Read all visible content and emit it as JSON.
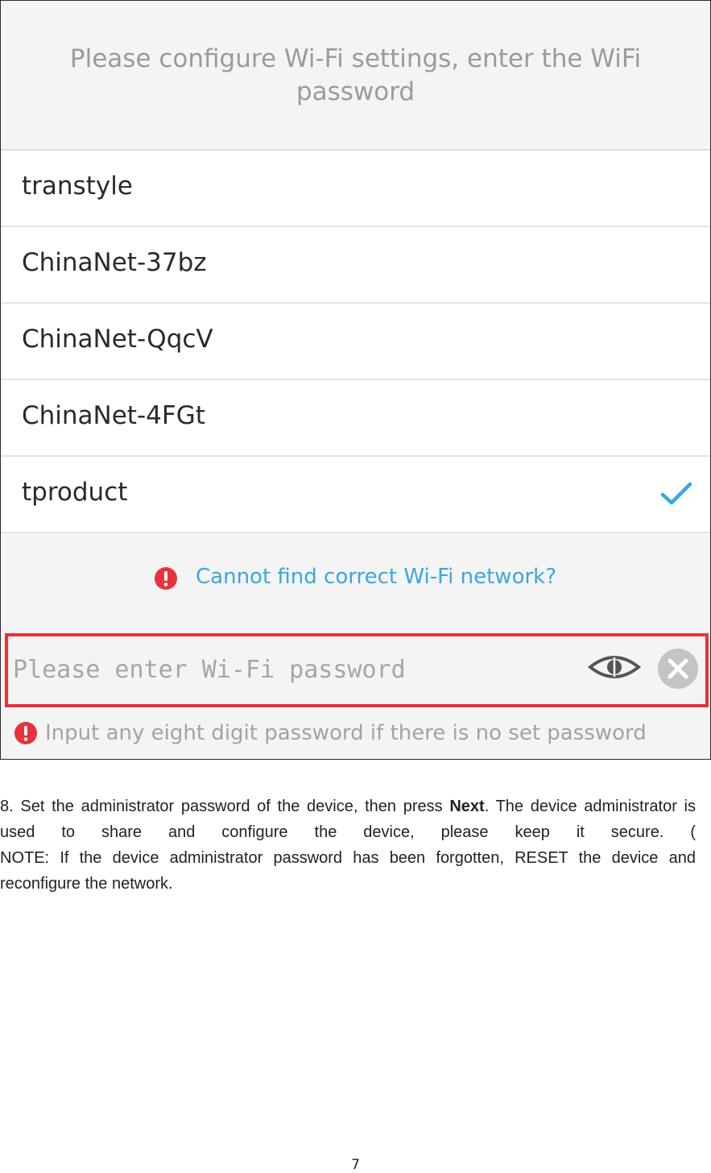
{
  "screen": {
    "header_title": "Please configure Wi-Fi settings, enter the WiFi password",
    "networks": [
      {
        "name": "transtyle",
        "selected": false
      },
      {
        "name": "ChinaNet-37bz",
        "selected": false
      },
      {
        "name": "ChinaNet-QqcV",
        "selected": false
      },
      {
        "name": "ChinaNet-4FGt",
        "selected": false
      },
      {
        "name": "tproduct",
        "selected": true
      }
    ],
    "cant_find_link": "Cannot find correct Wi-Fi network?",
    "password_field": {
      "placeholder": "Please enter Wi-Fi password",
      "value": ""
    },
    "hint": "Input any eight digit password if there is no set password",
    "icons": {
      "check": "check-icon",
      "alert": "alert-icon",
      "eye": "eye-icon",
      "clear": "clear-icon"
    },
    "colors": {
      "accent": "#38a8e0",
      "alert_red": "#e8323c",
      "highlight_border": "#e8323c"
    }
  },
  "document": {
    "step_number": "8.",
    "step_text_before": "Set the administrator password of the device, then press",
    "step_bold": "Next",
    "step_text_after": ". The device administrator is used to share and configure the device, please keep it secure. (",
    "note": "NOTE: If the device administrator password has been forgotten, RESET the device and reconfigure the network.",
    "page_number": "7"
  }
}
